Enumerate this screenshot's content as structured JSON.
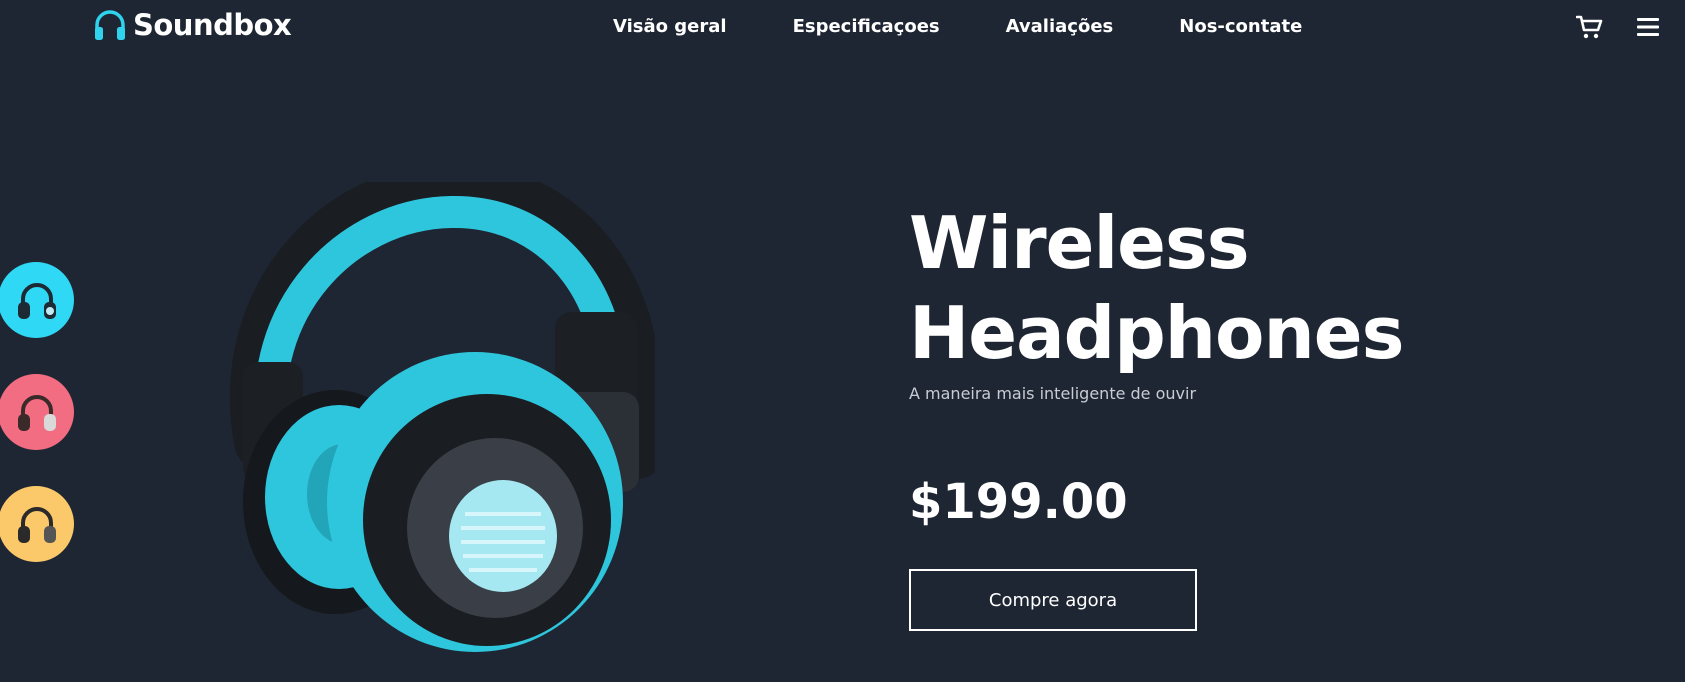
{
  "brand": {
    "name": "Soundbox",
    "icon": "headphones-icon",
    "accent": "#2fd3ee"
  },
  "nav": {
    "links": [
      "Visão geral",
      "Especificaçoes",
      "Avaliações",
      "Nos-contate"
    ],
    "cart_icon": "cart-icon",
    "menu_icon": "hamburger-menu-icon"
  },
  "thumbnails": [
    {
      "name": "cyan-headphones-thumbnail",
      "color": "#2fd8f5"
    },
    {
      "name": "pink-headphones-thumbnail",
      "color": "#f26d82"
    },
    {
      "name": "yellow-headphones-thumbnail",
      "color": "#fbc96a"
    }
  ],
  "hero": {
    "title_line1": "Wireless",
    "title_line2": "Headphones",
    "subtitle": "A maneira mais inteligente de ouvir",
    "price": "$199.00",
    "cta": "Compre agora"
  },
  "colors": {
    "background": "#1f2633",
    "headphone_accent": "#2ec6dc"
  }
}
